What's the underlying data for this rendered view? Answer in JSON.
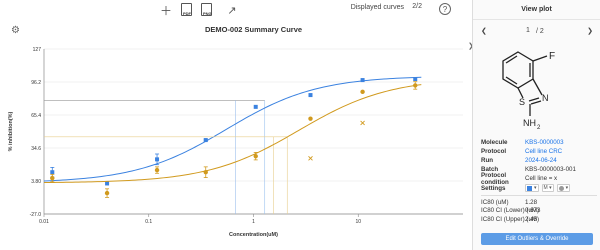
{
  "toolbar": {
    "add_icon": "plus-icon",
    "pdf_icon": "pdf-file-icon",
    "pdf_label": "PDF",
    "png_icon": "png-file-icon",
    "png_label": "PNG",
    "displayed_curves_label": "Displayed curves",
    "displayed_curves_count": "2/2",
    "help_icon": "?"
  },
  "settings_icon": "gear-icon",
  "chart_data": {
    "type": "line",
    "title": "DEMO-002 Summary Curve",
    "xlabel": "Concentration(uM)",
    "ylabel": "% inhibition(%)",
    "x_scale": "log",
    "xlim": [
      0.01,
      100
    ],
    "x_ticks": [
      0.01,
      0.1,
      1,
      10
    ],
    "x_tick_labels": [
      "0.01",
      "0.1",
      "1",
      "10"
    ],
    "ylim": [
      -27.0,
      127
    ],
    "y_ticks": [
      -27.0,
      3.8,
      34.6,
      65.4,
      96.2,
      127
    ],
    "y_tick_labels": [
      "-27.0",
      "3.80",
      "34.6",
      "65.4",
      "96.2",
      "127"
    ],
    "series": [
      {
        "color": "#3b82e0",
        "marker": "square",
        "points": [
          {
            "x": 0.012,
            "y": 12.0,
            "err": 4.5
          },
          {
            "x": 0.04,
            "y": 1.5,
            "err": 0
          },
          {
            "x": 0.12,
            "y": 24.0,
            "err": 5.0
          },
          {
            "x": 0.35,
            "y": 42.0,
            "err": 0.8
          },
          {
            "x": 1.05,
            "y": 73.0,
            "err": 0
          },
          {
            "x": 3.5,
            "y": 84.0,
            "err": 0
          },
          {
            "x": 11.0,
            "y": 98.0,
            "err": 0
          },
          {
            "x": 35.0,
            "y": 99.0,
            "err": 0
          }
        ],
        "curve": {
          "bottom": 2.0,
          "top": 102.0,
          "ic50": 0.55,
          "hill": 1.0
        },
        "ic50_guide_x": 1.28,
        "ic50_guide_y": 79.0,
        "ci_lines_x": [
          0.673
        ]
      },
      {
        "color": "#d19a1e",
        "marker": "circle",
        "points": [
          {
            "x": 0.012,
            "y": 6.5,
            "err": 3.5
          },
          {
            "x": 0.04,
            "y": -7.5,
            "err": 4.0
          },
          {
            "x": 0.12,
            "y": 14.0,
            "err": 3.0
          },
          {
            "x": 0.35,
            "y": 12.0,
            "err": 5.0
          },
          {
            "x": 1.05,
            "y": 27.0,
            "err": 3.5
          },
          {
            "x": 3.5,
            "y": 62.0,
            "err": 0
          },
          {
            "x": 11.0,
            "y": 87.0,
            "err": 0
          },
          {
            "x": 35.0,
            "y": 93.0,
            "err": 3.5
          }
        ],
        "outliers": [
          {
            "x": 3.5,
            "y": 25.0
          },
          {
            "x": 11.0,
            "y": 58.0
          }
        ],
        "curve": {
          "bottom": 2.0,
          "top": 100.0,
          "ic50": 2.7,
          "hill": 1.0
        },
        "ic50_guide_x": 2.1,
        "ic50_guide_y": 45.0,
        "ci_lines_x": [
          1.55
        ]
      }
    ]
  },
  "panel": {
    "title": "View plot",
    "prev_icon": "chevron-left-icon",
    "next_icon": "chevron-right-icon",
    "page_current": "1",
    "page_total": "/ 2",
    "structure": {
      "name": "molecule-structure",
      "substituent_label": "F",
      "ring_s": "S",
      "ring_n": "N",
      "amine_label": "NH",
      "amine_subscript": "2"
    },
    "properties": [
      {
        "key": "Molecule",
        "value": "KBS-0000003",
        "link": true
      },
      {
        "key": "Protocol",
        "value": "Cell line CRC",
        "link": true
      },
      {
        "key": "Run",
        "value": "2024-06-24",
        "link": true
      },
      {
        "key": "Batch",
        "value": "KBS-0000003-001",
        "link": false
      },
      {
        "key": "Protocol condition",
        "value": "Cell line = x",
        "link": false
      }
    ],
    "settings_label": "Settings",
    "settings_marker_value": "M",
    "results": [
      {
        "key": "IC80 (uM)",
        "value": "1.28"
      },
      {
        "key": "IC80 CI (Lower) (uM)",
        "value": "0.673"
      },
      {
        "key": "IC80 CI (Upper) (uM)",
        "value": "2.45"
      }
    ],
    "edit_button_label": "Edit Outliers & Override"
  }
}
